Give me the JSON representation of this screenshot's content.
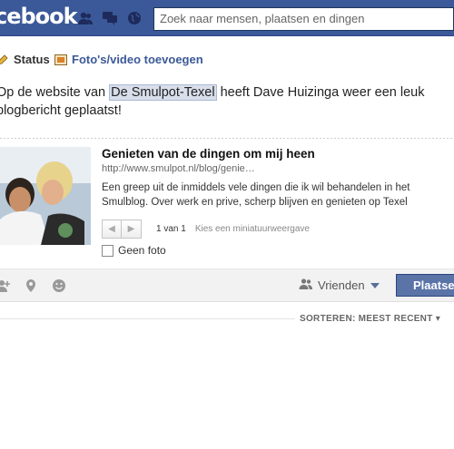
{
  "header": {
    "logo_text": "cebook",
    "search_placeholder": "Zoek naar mensen, plaatsen en dingen",
    "icons": [
      "friend-requests-icon",
      "messages-icon",
      "notifications-globe-icon"
    ]
  },
  "composer": {
    "tabs": {
      "status": "Status",
      "photo": "Foto's/video toevoegen"
    },
    "text_before": "Op de website van ",
    "tagged_page": "De Smulpot-Texel",
    "text_after": " heeft Dave Huizinga weer een leuk blogbericht geplaatst!"
  },
  "attachment": {
    "title": "Genieten van de dingen om mij heen",
    "url": "http://www.smulpot.nl/blog/genie…",
    "description": "Een greep uit de inmiddels vele dingen die ik wil behandelen in het Smulblog. Over werk en prive, scherp blijven en genieten op Texel",
    "pager_count": "1 van 1",
    "pager_hint": "Kies een miniatuurweergave",
    "no_photo_label": "Geen foto"
  },
  "bottom_bar": {
    "icons": [
      "tag-friends-icon",
      "location-pin-icon",
      "smiley-icon"
    ],
    "audience": "Vrienden",
    "post_button": "Plaatsen"
  },
  "feed": {
    "sort_label": "SORTEREN: MEEST RECENT ▾"
  },
  "colors": {
    "brand_blue": "#3b5998",
    "button_blue": "#5b74a8",
    "highlight": "#d8dfea"
  }
}
